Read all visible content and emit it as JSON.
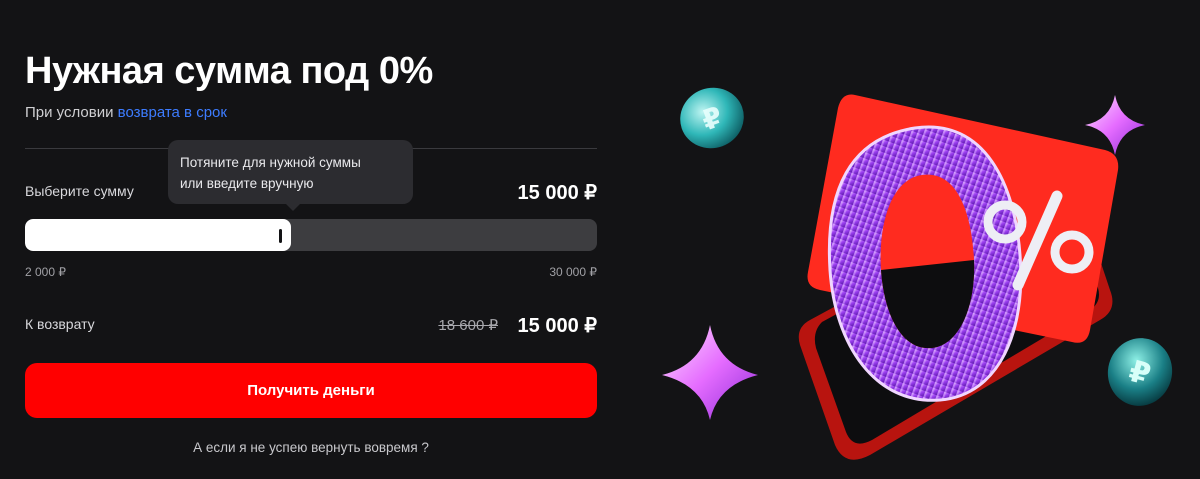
{
  "header": {
    "title": "Нужная сумма под 0%",
    "subtitle_prefix": "При условии",
    "subtitle_link": "возврата в срок"
  },
  "tooltip": {
    "line1": "Потяните для нужной суммы",
    "line2": "или введите вручную"
  },
  "amount_select": {
    "label": "Выберите сумму",
    "value_display": "15 000 ₽",
    "min_label": "2 000 ₽",
    "max_label": "30 000 ₽",
    "slider": {
      "min": 2000,
      "max": 30000,
      "value": 15000
    }
  },
  "repayment": {
    "label": "К возврату",
    "old_amount": "18 600 ₽",
    "new_amount": "15 000 ₽"
  },
  "cta_label": "Получить деньги",
  "faq_link": "А если я не успею вернуть вовремя ?",
  "promo_art": {
    "big_digit": "0",
    "percent_sign": "%",
    "coin_symbol": "₽"
  },
  "colors": {
    "background": "#131315",
    "accent_red": "#ff0000",
    "link_blue": "#3d7cff",
    "track": "#3d3d40"
  }
}
